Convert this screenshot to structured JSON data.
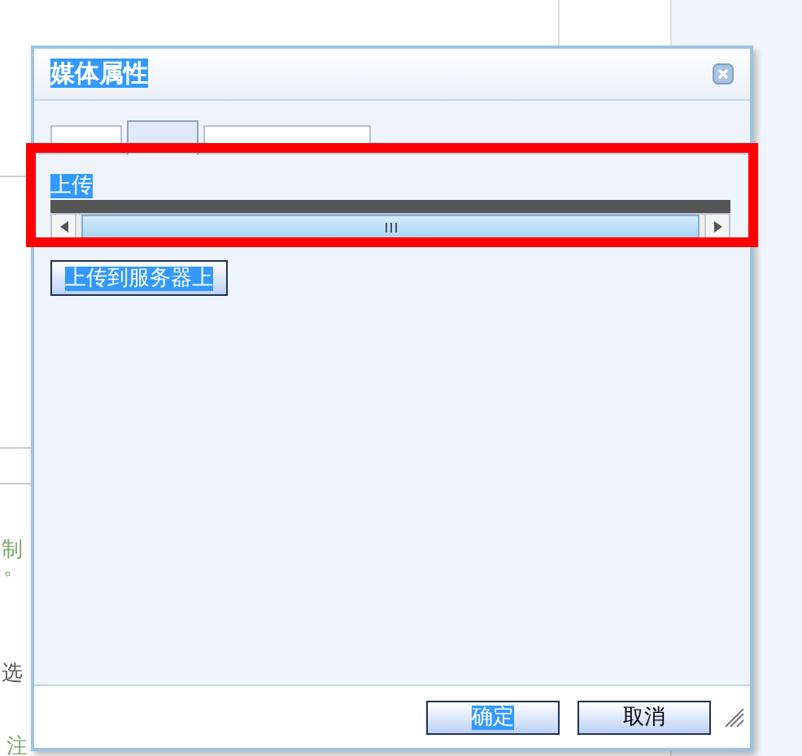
{
  "background": {
    "fragments": [
      {
        "text": "制"
      },
      {
        "text": "。"
      },
      {
        "text": "选"
      },
      {
        "text": "注"
      }
    ]
  },
  "dialog": {
    "title": "媒体属性",
    "title_highlighted": true,
    "tabs": [
      {
        "selected": false
      },
      {
        "selected": true
      },
      {
        "selected": false
      }
    ],
    "upload": {
      "label": "上传",
      "label_highlighted": true,
      "button": {
        "label": "上传到服务器上",
        "highlighted": true
      }
    },
    "buttons": [
      {
        "label": "确定",
        "highlighted": true
      },
      {
        "label": "取消",
        "highlighted": false
      }
    ]
  },
  "annotation": {
    "kind": "frame",
    "color": "#ff0000"
  }
}
